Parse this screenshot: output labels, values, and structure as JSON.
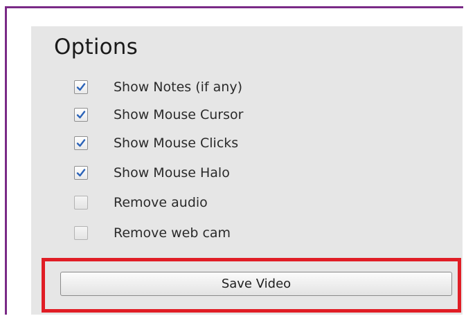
{
  "options": {
    "title": "Options",
    "items": [
      {
        "label": "Show Notes (if any)",
        "checked": true
      },
      {
        "label": "Show Mouse Cursor",
        "checked": true
      },
      {
        "label": "Show Mouse Clicks",
        "checked": true
      },
      {
        "label": "Show Mouse Halo",
        "checked": true
      },
      {
        "label": "Remove audio",
        "checked": false
      },
      {
        "label": "Remove web cam",
        "checked": false
      }
    ]
  },
  "actions": {
    "save_label": "Save Video"
  },
  "colors": {
    "frame_border": "#7a2a86",
    "highlight_border": "#e01d25",
    "checkmark": "#2b63b8"
  }
}
